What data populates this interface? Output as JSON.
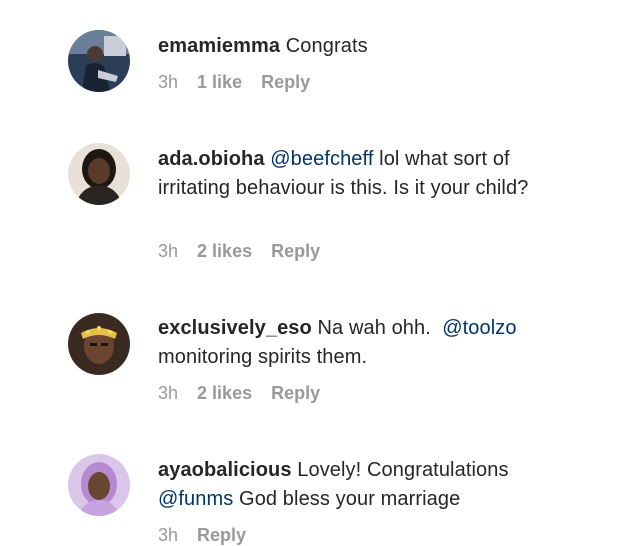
{
  "colors": {
    "username": "#262626",
    "text": "#262626",
    "mention": "#003569",
    "meta": "#999999",
    "background": "#ffffff"
  },
  "comments": [
    {
      "username": "emamiemma",
      "text": "Congrats",
      "time": "3h",
      "likes": "1 like",
      "reply": "Reply",
      "avatar_icon": "profile-photo-icon"
    },
    {
      "username": "ada.obioha",
      "mention": "@beefcheff",
      "text": "lol what sort of irritating behaviour is this. Is it your child?",
      "time": "3h",
      "likes": "2 likes",
      "reply": "Reply",
      "avatar_icon": "profile-photo-icon"
    },
    {
      "username": "exclusively_eso",
      "text_before": "Na wah ohh.",
      "mention": "@toolzo",
      "text_after": "monitoring spirits them.",
      "time": "3h",
      "likes": "2 likes",
      "reply": "Reply",
      "avatar_icon": "profile-photo-icon"
    },
    {
      "username": "ayaobalicious",
      "text_before": "Lovely! Congratulations",
      "mention": "@funms",
      "text_after": "God bless your marriage",
      "time": "3h",
      "reply": "Reply",
      "avatar_icon": "profile-photo-icon"
    }
  ]
}
